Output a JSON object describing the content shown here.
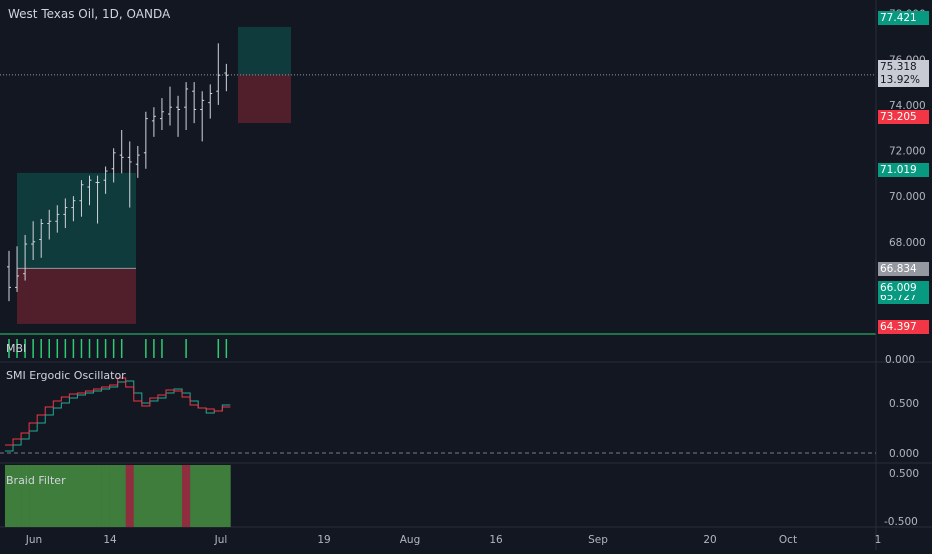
{
  "header": {
    "symbol_title": "West Texas Oil, 1D, OANDA"
  },
  "panes": {
    "mbi_label": "MBI",
    "smi_label": "SMI Ergodic Oscillator",
    "braid_label": "Braid Filter"
  },
  "price_axis": {
    "ticks": [
      "78.000",
      "76.000",
      "74.000",
      "72.000",
      "70.000",
      "68.000"
    ],
    "tags": [
      {
        "value": "77.421",
        "color": "#089981"
      },
      {
        "value": "75.318",
        "color": "#c8cbd3"
      },
      {
        "value": "13.92%",
        "color": "#c8cbd3"
      },
      {
        "value": "73.205",
        "color": "#f23645"
      },
      {
        "value": "71.019",
        "color": "#089981"
      },
      {
        "value": "66.834",
        "color": "#9598a1"
      },
      {
        "value": "66.009",
        "color": "#089981"
      },
      {
        "value": "65.727",
        "color": "#089981"
      },
      {
        "value": "64.397",
        "color": "#f23645"
      }
    ]
  },
  "mbi_axis": {
    "tick": "0.000"
  },
  "smi_axis": {
    "ticks": [
      "0.500",
      "0.000"
    ]
  },
  "braid_axis": {
    "ticks": [
      "0.500",
      "-0.500"
    ]
  },
  "time_axis": {
    "labels": [
      "Jun",
      "14",
      "Jul",
      "19",
      "Aug",
      "16",
      "Sep",
      "20",
      "Oct",
      "1"
    ]
  },
  "colors": {
    "background": "#131722",
    "bar": "#d1d4dc",
    "profit_zone": "#089981",
    "loss_zone": "#f23645",
    "smi_line": "#f23645",
    "smi_signal": "#22ab94",
    "braid_green": "#3e7d3c",
    "braid_red": "#8e2e3e",
    "mbi_bar": "#2ecc71"
  },
  "chart_data": {
    "type": "ohlc",
    "series": [
      {
        "name": "West Texas Oil",
        "ohlc": [
          [
            66.9,
            67.6,
            65.4,
            66.0
          ],
          [
            66.0,
            67.8,
            65.8,
            66.5
          ],
          [
            66.6,
            68.3,
            66.3,
            67.9
          ],
          [
            67.9,
            68.9,
            67.2,
            68.0
          ],
          [
            68.1,
            69.0,
            67.3,
            68.8
          ],
          [
            68.8,
            69.4,
            68.1,
            68.9
          ],
          [
            68.9,
            69.6,
            68.4,
            69.2
          ],
          [
            69.2,
            69.9,
            68.6,
            69.5
          ],
          [
            69.5,
            70.0,
            68.9,
            69.8
          ],
          [
            69.8,
            70.7,
            69.1,
            70.5
          ],
          [
            70.4,
            70.9,
            69.6,
            70.7
          ],
          [
            70.6,
            70.9,
            68.8,
            70.6
          ],
          [
            70.7,
            71.3,
            70.1,
            71.1
          ],
          [
            71.2,
            72.1,
            70.6,
            71.9
          ],
          [
            71.8,
            72.9,
            71.0,
            71.7
          ],
          [
            71.7,
            72.4,
            69.5,
            71.5
          ],
          [
            71.4,
            72.2,
            70.8,
            71.8
          ],
          [
            71.9,
            73.7,
            71.2,
            73.4
          ],
          [
            73.3,
            73.9,
            72.6,
            73.5
          ],
          [
            73.4,
            74.3,
            72.9,
            73.7
          ],
          [
            73.6,
            74.8,
            73.1,
            73.9
          ],
          [
            73.9,
            74.4,
            72.6,
            73.8
          ],
          [
            73.9,
            75.0,
            72.9,
            74.7
          ],
          [
            74.6,
            75.0,
            73.2,
            73.8
          ],
          [
            73.8,
            74.6,
            72.4,
            74.2
          ],
          [
            74.1,
            74.9,
            73.4,
            74.5
          ],
          [
            74.6,
            76.7,
            74.0,
            75.3
          ],
          [
            75.4,
            75.8,
            74.6,
            75.3
          ]
        ]
      }
    ],
    "smi": {
      "oscillator": [
        0.08,
        0.14,
        0.2,
        0.3,
        0.38,
        0.46,
        0.52,
        0.56,
        0.59,
        0.6,
        0.62,
        0.64,
        0.66,
        0.68,
        0.75,
        0.66,
        0.52,
        0.47,
        0.55,
        0.58,
        0.63,
        0.62,
        0.56,
        0.48,
        0.45,
        0.44,
        0.42,
        0.46
      ],
      "signal": [
        0.02,
        0.08,
        0.14,
        0.22,
        0.3,
        0.38,
        0.45,
        0.5,
        0.55,
        0.58,
        0.6,
        0.62,
        0.64,
        0.66,
        0.71,
        0.72,
        0.6,
        0.5,
        0.52,
        0.55,
        0.6,
        0.64,
        0.6,
        0.52,
        0.45,
        0.4,
        0.42,
        0.48
      ]
    },
    "braid": [
      "g",
      "g",
      "g",
      "g",
      "g",
      "g",
      "g",
      "g",
      "g",
      "g",
      "g",
      "g",
      "g",
      "g",
      "g",
      "r",
      "g",
      "g",
      "g",
      "g",
      "g",
      "g",
      "r",
      "g",
      "g",
      "g",
      "g",
      "g"
    ],
    "mbi": [
      1,
      1,
      1,
      1,
      1,
      1,
      1,
      1,
      1,
      1,
      1,
      1,
      1,
      1,
      1,
      0,
      0,
      1,
      1,
      1,
      0,
      0,
      1,
      0,
      0,
      0,
      1,
      1
    ],
    "ylim_price": [
      64,
      78.6
    ],
    "ylim_smi": [
      -0.05,
      0.85
    ]
  }
}
